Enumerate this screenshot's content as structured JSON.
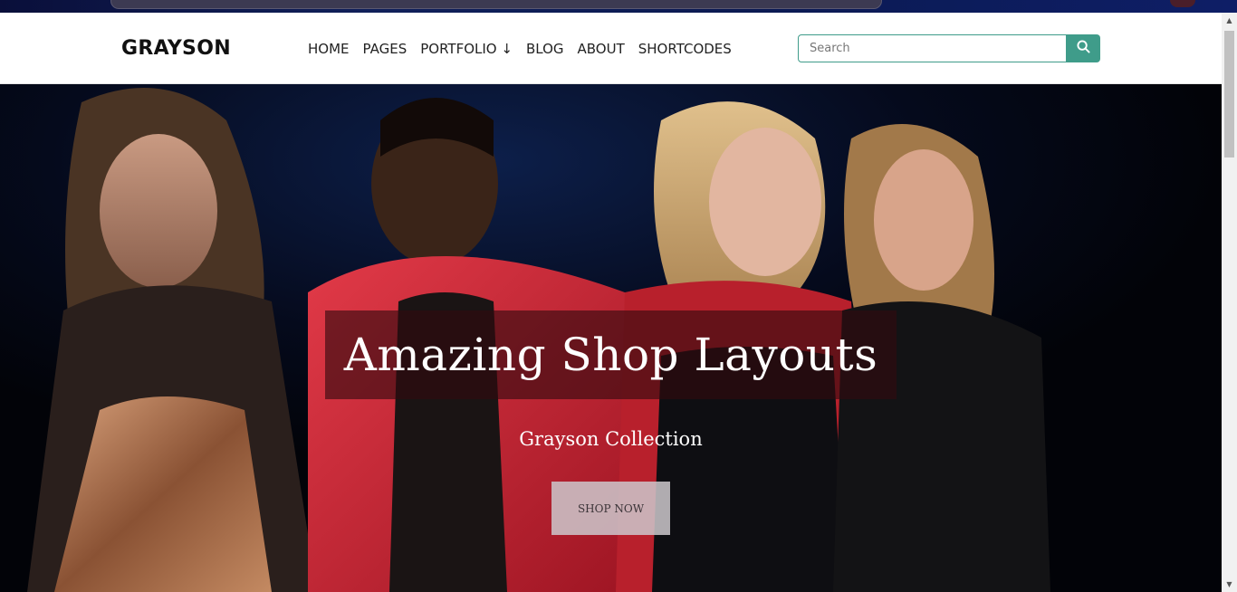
{
  "site": {
    "logo": "GRAYSON"
  },
  "nav": {
    "items": [
      {
        "label": "HOME"
      },
      {
        "label": "PAGES"
      },
      {
        "label": "PORTFOLIO ↓"
      },
      {
        "label": "BLOG"
      },
      {
        "label": "ABOUT"
      },
      {
        "label": "SHORTCODES"
      }
    ]
  },
  "search": {
    "placeholder": "Search",
    "value": "",
    "icon": "search-icon"
  },
  "hero": {
    "title": "Amazing Shop Layouts",
    "subtitle": "Grayson Collection",
    "button_label": "SHOP NOW"
  },
  "colors": {
    "accent": "#3f9c8a",
    "header_bg": "#ffffff",
    "hero_bg": "#050810",
    "title_box": "#320a0e"
  }
}
